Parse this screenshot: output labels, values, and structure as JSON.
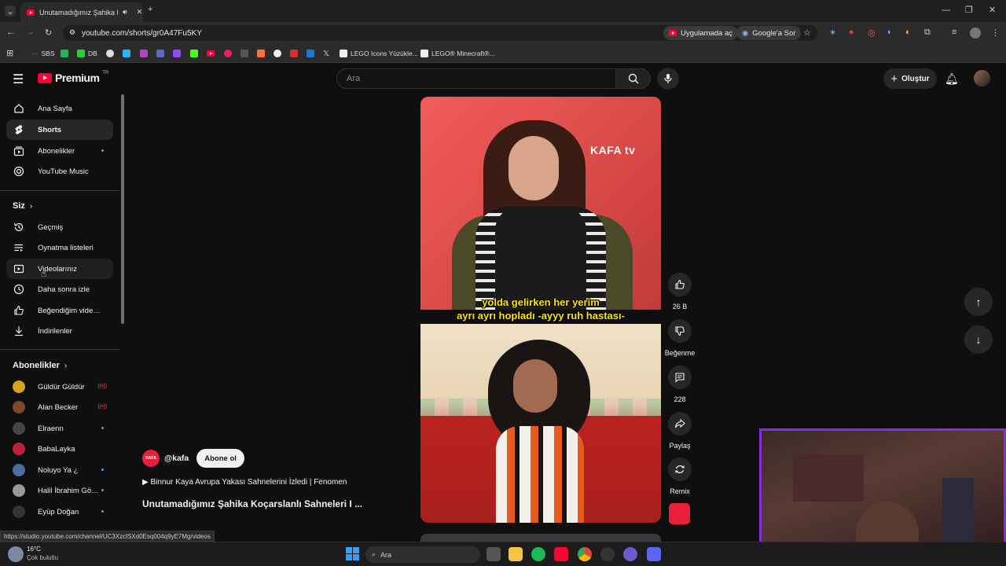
{
  "browser": {
    "tab_title": "Unutamadığımız Şahika Koç",
    "url": "youtube.com/shorts/gr0A47Fu5KY",
    "open_in_app": "Uygulamada aç",
    "ask_google": "Google'a Sor",
    "bookmarks": [
      "SBS",
      "DB",
      "LEGO Icons Yüzükle...",
      "LEGO® Minecraft®..."
    ]
  },
  "header": {
    "logo": "Premium",
    "logo_badge": "TR",
    "search_placeholder": "Ara",
    "create_label": "Oluştur"
  },
  "sidebar": {
    "main": [
      {
        "label": "Ana Sayfa",
        "icon": "home-icon"
      },
      {
        "label": "Shorts",
        "icon": "shorts-icon"
      },
      {
        "label": "Abonelikler",
        "icon": "subscriptions-icon"
      },
      {
        "label": "YouTube Music",
        "icon": "music-icon"
      }
    ],
    "you_heading": "Siz",
    "you": [
      {
        "label": "Geçmiş",
        "icon": "history-icon"
      },
      {
        "label": "Oynatma listeleri",
        "icon": "playlist-icon"
      },
      {
        "label": "Videolarınız",
        "icon": "your-videos-icon"
      },
      {
        "label": "Daha sonra izle",
        "icon": "watch-later-icon"
      },
      {
        "label": "Beğendiğim videolar",
        "icon": "liked-icon"
      },
      {
        "label": "İndirilenler",
        "icon": "download-icon"
      }
    ],
    "subs_heading": "Abonelikler",
    "subs": [
      {
        "label": "Güldür Güldür",
        "color": "#d9a020"
      },
      {
        "label": "Alan Becker",
        "color": "#7a4a2a"
      },
      {
        "label": "Elraenn",
        "color": "#444"
      },
      {
        "label": "BabaLayka",
        "color": "#c02040"
      },
      {
        "label": "Noluyo Ya ¿",
        "color": "#4a6ea0"
      },
      {
        "label": "Halil İbrahim Gök...",
        "color": "#999"
      },
      {
        "label": "Eyüp Doğan",
        "color": "#333"
      }
    ]
  },
  "short": {
    "caption_line1": "yolda gelirken her yerim",
    "caption_line2": "ayrı ayrı hopladı -ayyy ruh hastası-",
    "watermark": "KAFA tv",
    "channel": "@kafa",
    "subscribe_label": "Abone ol",
    "related": "▶ Binnur Kaya Avrupa Yakası Sahnelerini İzledi | Fenomen",
    "title": "Unutamadığımız Şahika Koçarslanlı Sahneleri I ...",
    "likes": "26 B",
    "dislike_label": "Beğenme",
    "comments": "228",
    "share_label": "Paylaş",
    "remix_label": "Remix"
  },
  "status_url": "https://studio.youtube.com/channel/UC3XzclSXd0Esq004q9yE7Mg/videos",
  "taskbar": {
    "weather_temp": "16°C",
    "weather_desc": "Çok bulutlu",
    "search_placeholder": "Ara"
  }
}
